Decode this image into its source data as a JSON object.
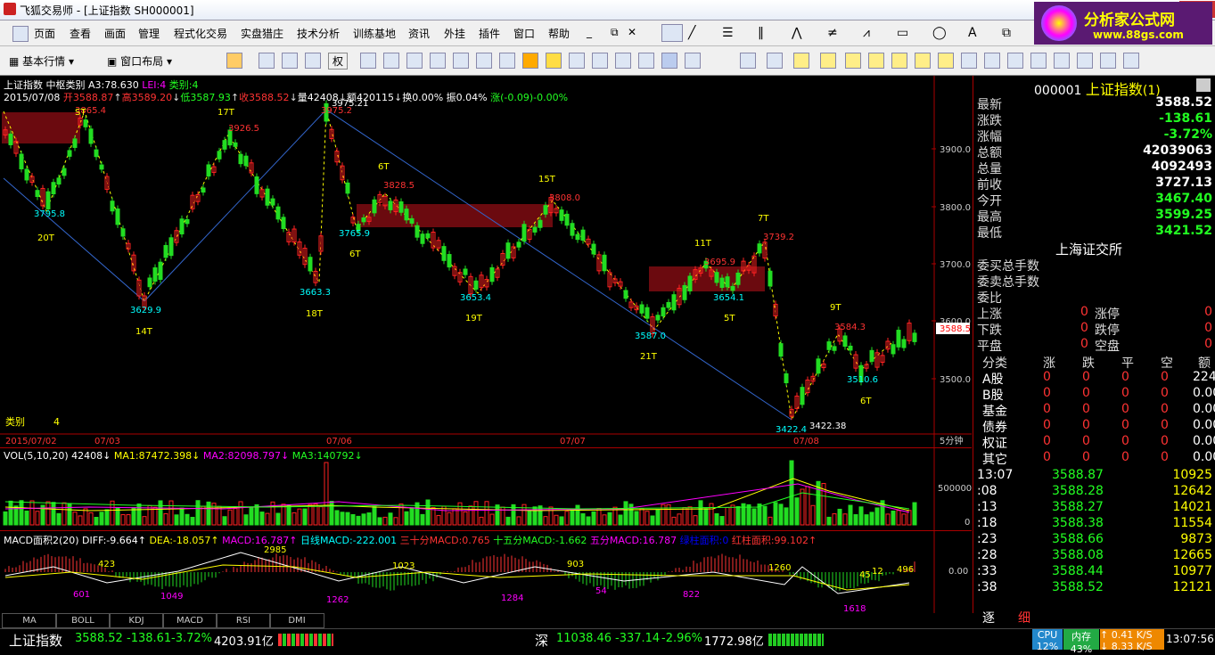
{
  "window": {
    "app": "飞狐交易师",
    "doc": "[上证指数 SH000001]",
    "min": "—",
    "max": "□",
    "close": "✕"
  },
  "menu": [
    "页面",
    "查看",
    "画面",
    "管理",
    "程式化交易",
    "实盘猎庄",
    "技术分析",
    "训练基地",
    "资讯",
    "外挂",
    "插件",
    "窗口",
    "帮助"
  ],
  "toolbar2": {
    "basic": "基本行情",
    "layout": "窗口布局",
    "quan": "权"
  },
  "ad": {
    "name": "分析家公式网",
    "url": "www.88gs.com"
  },
  "chart_header": {
    "title": "上证指数",
    "indicator": "中枢类别",
    "a3": "A3:78.630",
    "lei": "LEI:4",
    "cat": "类别:4",
    "date": "2015/07/08",
    "open": "开3588.87",
    "high": "高3589.20",
    "low": "低3587.93",
    "close": "收3588.52",
    "vol": "量42408",
    "amt": "额420115",
    "turn": "换0.00%",
    "amp": "振0.04%",
    "chg": "涨(-0.09)-0.00%"
  },
  "chart_data": {
    "type": "line",
    "price_axis": [
      "3900.0",
      "3800.0",
      "3700.0",
      "3600.0",
      "3500.0"
    ],
    "current_price": "3588.5",
    "points": [
      {
        "label": "3865.4",
        "cls": "red"
      },
      {
        "label": "3795.8",
        "cls": "cyan"
      },
      {
        "label": "3926.5",
        "cls": "red"
      },
      {
        "label": "3629.9",
        "cls": "cyan"
      },
      {
        "label": "3975.2",
        "cls": "red"
      },
      {
        "label": "3975.21",
        "cls": "white"
      },
      {
        "label": "3663.3",
        "cls": "cyan"
      },
      {
        "label": "3828.5",
        "cls": "red"
      },
      {
        "label": "3765.9",
        "cls": "cyan"
      },
      {
        "label": "3653.4",
        "cls": "cyan"
      },
      {
        "label": "3808.0",
        "cls": "red"
      },
      {
        "label": "3587.0",
        "cls": "cyan"
      },
      {
        "label": "3695.9",
        "cls": "red"
      },
      {
        "label": "3654.1",
        "cls": "cyan"
      },
      {
        "label": "3739.2",
        "cls": "red"
      },
      {
        "label": "3422.4",
        "cls": "cyan"
      },
      {
        "label": "3422.38",
        "cls": "white"
      },
      {
        "label": "3584.3",
        "cls": "red"
      },
      {
        "label": "3510.6",
        "cls": "cyan"
      }
    ],
    "t_labels": [
      "20T",
      "17T",
      "14T",
      "18T",
      "6T",
      "6T",
      "19T",
      "15T",
      "21T",
      "11T",
      "5T",
      "7T",
      "9T",
      "6T",
      "ST"
    ],
    "cat_label": "类别",
    "cat_value": "4",
    "x_dates": [
      "2015/07/02",
      "07/03",
      "07/06",
      "07/07",
      "07/08"
    ],
    "period": "5分钟"
  },
  "vol_panel": {
    "head": "VOL(5,10,20) 42408↓",
    "ma1": "MA1:87472.398↓",
    "ma2": "MA2:82098.797↓",
    "ma3": "MA3:140792↓",
    "axis": [
      "500000",
      "0"
    ]
  },
  "macd_panel": {
    "head": "MACD面积2(20) DIFF:-9.664↑",
    "dea": "DEA:-18.057↑",
    "macd": "MACD:16.787↑",
    "day": "日线MACD:-222.001",
    "m30": "三十分MACD:0.765",
    "m15": "十五分MACD:-1.662",
    "m5": "五分MACD:16.787",
    "green_area": "绿柱面积:0",
    "red_area": "红柱面积:99.102↑",
    "axis": "0.00",
    "labels": [
      "423",
      "2985",
      "1023",
      "903",
      "1260",
      "45",
      "12",
      "496",
      "601",
      "1049",
      "1262",
      "1284",
      "54",
      "822",
      "1618"
    ]
  },
  "tabs": [
    "MA",
    "BOLL",
    "KDJ",
    "MACD",
    "RSI",
    "DMI"
  ],
  "quote": {
    "code": "000001",
    "name": "上证指数",
    "suffix": "(1)",
    "rows": [
      {
        "l": "最新",
        "v": "3588.52",
        "c": "white"
      },
      {
        "l": "涨跌",
        "v": "-138.61",
        "c": "green"
      },
      {
        "l": "涨幅",
        "v": "-3.72%",
        "c": "green"
      },
      {
        "l": "总额",
        "v": "42039063",
        "c": "white"
      },
      {
        "l": "总量",
        "v": "4092493",
        "c": "white"
      },
      {
        "l": "前收",
        "v": "3727.13",
        "c": "white"
      },
      {
        "l": "今开",
        "v": "3467.40",
        "c": "green"
      },
      {
        "l": "最高",
        "v": "3599.25",
        "c": "green"
      },
      {
        "l": "最低",
        "v": "3421.52",
        "c": "green"
      }
    ],
    "exchange": "上海证交所",
    "orders": [
      "委买总手数",
      "委卖总手数",
      "委比"
    ],
    "updown": [
      {
        "a": "上涨",
        "av": "0",
        "b": "涨停",
        "bv": "0"
      },
      {
        "a": "下跌",
        "av": "0",
        "b": "跌停",
        "bv": "0"
      },
      {
        "a": "平盘",
        "av": "0",
        "b": "空盘",
        "bv": "0"
      }
    ],
    "cat_head": [
      "分类",
      "涨",
      "跌",
      "平",
      "空",
      "额"
    ],
    "cats": [
      {
        "n": "A股",
        "v": [
          "0",
          "0",
          "0",
          "0",
          "224"
        ]
      },
      {
        "n": "B股",
        "v": [
          "0",
          "0",
          "0",
          "0",
          "0.00"
        ]
      },
      {
        "n": "基金",
        "v": [
          "0",
          "0",
          "0",
          "0",
          "0.00"
        ]
      },
      {
        "n": "债券",
        "v": [
          "0",
          "0",
          "0",
          "0",
          "0.00"
        ]
      },
      {
        "n": "权证",
        "v": [
          "0",
          "0",
          "0",
          "0",
          "0.00"
        ]
      },
      {
        "n": "其它",
        "v": [
          "0",
          "0",
          "0",
          "0",
          "0.00"
        ]
      }
    ],
    "ticks": [
      {
        "t": "13:07",
        "p": "3588.87",
        "v": "10925"
      },
      {
        "t": ":08",
        "p": "3588.28",
        "v": "12642"
      },
      {
        "t": ":13",
        "p": "3588.27",
        "v": "14021"
      },
      {
        "t": ":18",
        "p": "3588.38",
        "v": "11554"
      },
      {
        "t": ":23",
        "p": "3588.66",
        "v": "9873"
      },
      {
        "t": ":28",
        "p": "3588.08",
        "v": "12665"
      },
      {
        "t": ":33",
        "p": "3588.44",
        "v": "10977"
      },
      {
        "t": ":38",
        "p": "3588.52",
        "v": "12121"
      }
    ],
    "footer_tabs": [
      "逐",
      "细"
    ]
  },
  "status": {
    "sh_name": "上证指数",
    "sh_val": "3588.52",
    "sh_chg": "-138.61",
    "sh_pct": "-3.72%",
    "sh_amt": "4203.91亿",
    "sz_name": "深",
    "sz_val": "11038.46",
    "sz_chg": "-337.14",
    "sz_pct": "-2.96%",
    "sz_amt": "1772.98亿",
    "cpu": "CPU",
    "cpu_v": "12%",
    "mem": "内存",
    "mem_v": "43%",
    "up": "0.41 K/S",
    "down": "8.33 K/S",
    "time": "13:07:56"
  }
}
